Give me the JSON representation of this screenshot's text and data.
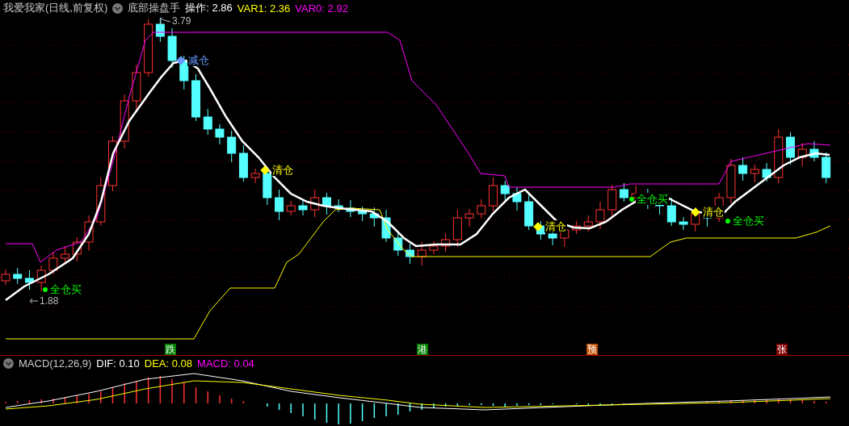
{
  "header": {
    "stock": "我爱我家(日线,前复权)",
    "indicator": "底部操盘手",
    "readings": [
      {
        "label": "操作: 2.86",
        "color": "#ffffff"
      },
      {
        "label": "VAR1: 2.36",
        "color": "#ffff00"
      },
      {
        "label": "VAR0: 2.92",
        "color": "#ff00ff"
      }
    ]
  },
  "price_marks": [
    {
      "kind": "high",
      "text": "3.79"
    },
    {
      "kind": "low",
      "text": "1.88"
    }
  ],
  "signals": [
    {
      "kind": "reduce",
      "label": "减仓"
    },
    {
      "kind": "clear",
      "label": "清仓"
    },
    {
      "kind": "buy",
      "label": "全仓买"
    },
    {
      "kind": "clear",
      "label": "清仓"
    },
    {
      "kind": "buy",
      "label": "全仓买"
    },
    {
      "kind": "clear",
      "label": "清仓"
    },
    {
      "kind": "buy",
      "label": "全仓买"
    }
  ],
  "date_marks": [
    {
      "label": "跌",
      "color": "#008000"
    },
    {
      "label": "港",
      "color": "#008000"
    },
    {
      "label": "预",
      "color": "#c05000"
    },
    {
      "label": "张",
      "color": "#800000"
    }
  ],
  "macd_header": {
    "title": "MACD(12,26,9)",
    "readings": [
      {
        "label": "DIF: 0.10",
        "color": "#ffffff"
      },
      {
        "label": "DEA: 0.08",
        "color": "#ffff00"
      },
      {
        "label": "MACD: 0.04",
        "color": "#ff00ff"
      }
    ]
  }
}
